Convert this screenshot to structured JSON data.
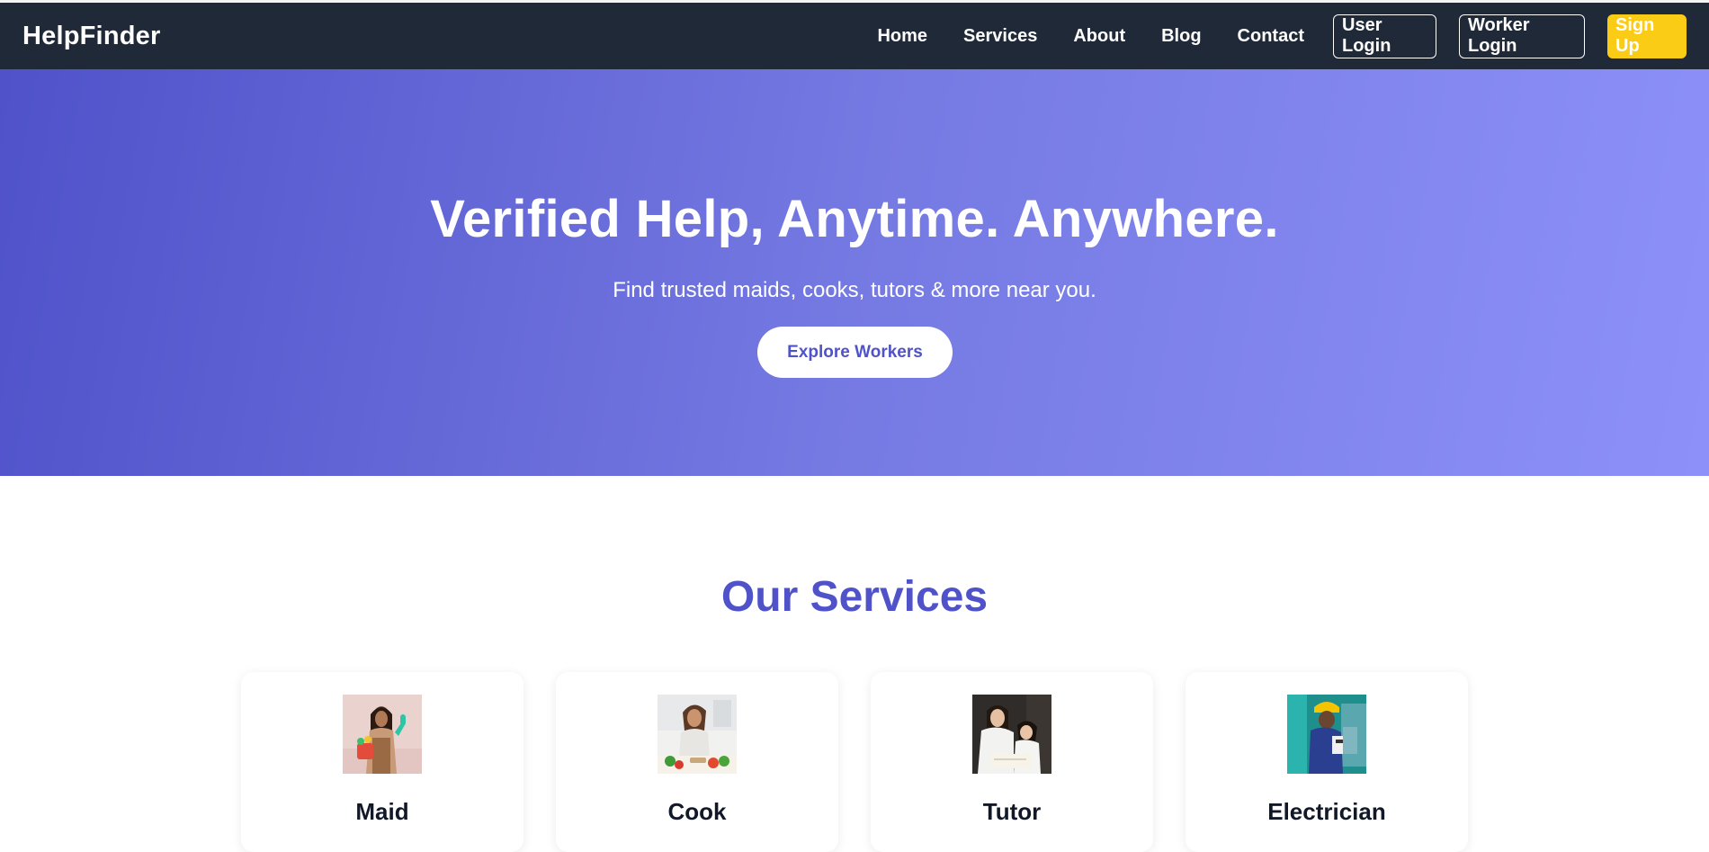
{
  "brand": "HelpFinder",
  "nav": {
    "links": [
      "Home",
      "Services",
      "About",
      "Blog",
      "Contact"
    ],
    "user_login": "User Login",
    "worker_login": "Worker Login",
    "sign_up": "Sign Up"
  },
  "hero": {
    "title": "Verified Help, Anytime. Anywhere.",
    "subtitle": "Find trusted maids, cooks, tutors & more near you.",
    "cta": "Explore Workers"
  },
  "services": {
    "title": "Our Services",
    "items": [
      {
        "name": "Maid",
        "image": "maid-photo"
      },
      {
        "name": "Cook",
        "image": "cook-photo"
      },
      {
        "name": "Tutor",
        "image": "tutor-photo"
      },
      {
        "name": "Electrician",
        "image": "electrician-photo"
      }
    ]
  },
  "colors": {
    "navbar": "#1f2937",
    "accent": "#4f52c9",
    "signup": "#facc15",
    "hero_gradient_start": "#4f52c9",
    "hero_gradient_end": "#8c90f8"
  }
}
